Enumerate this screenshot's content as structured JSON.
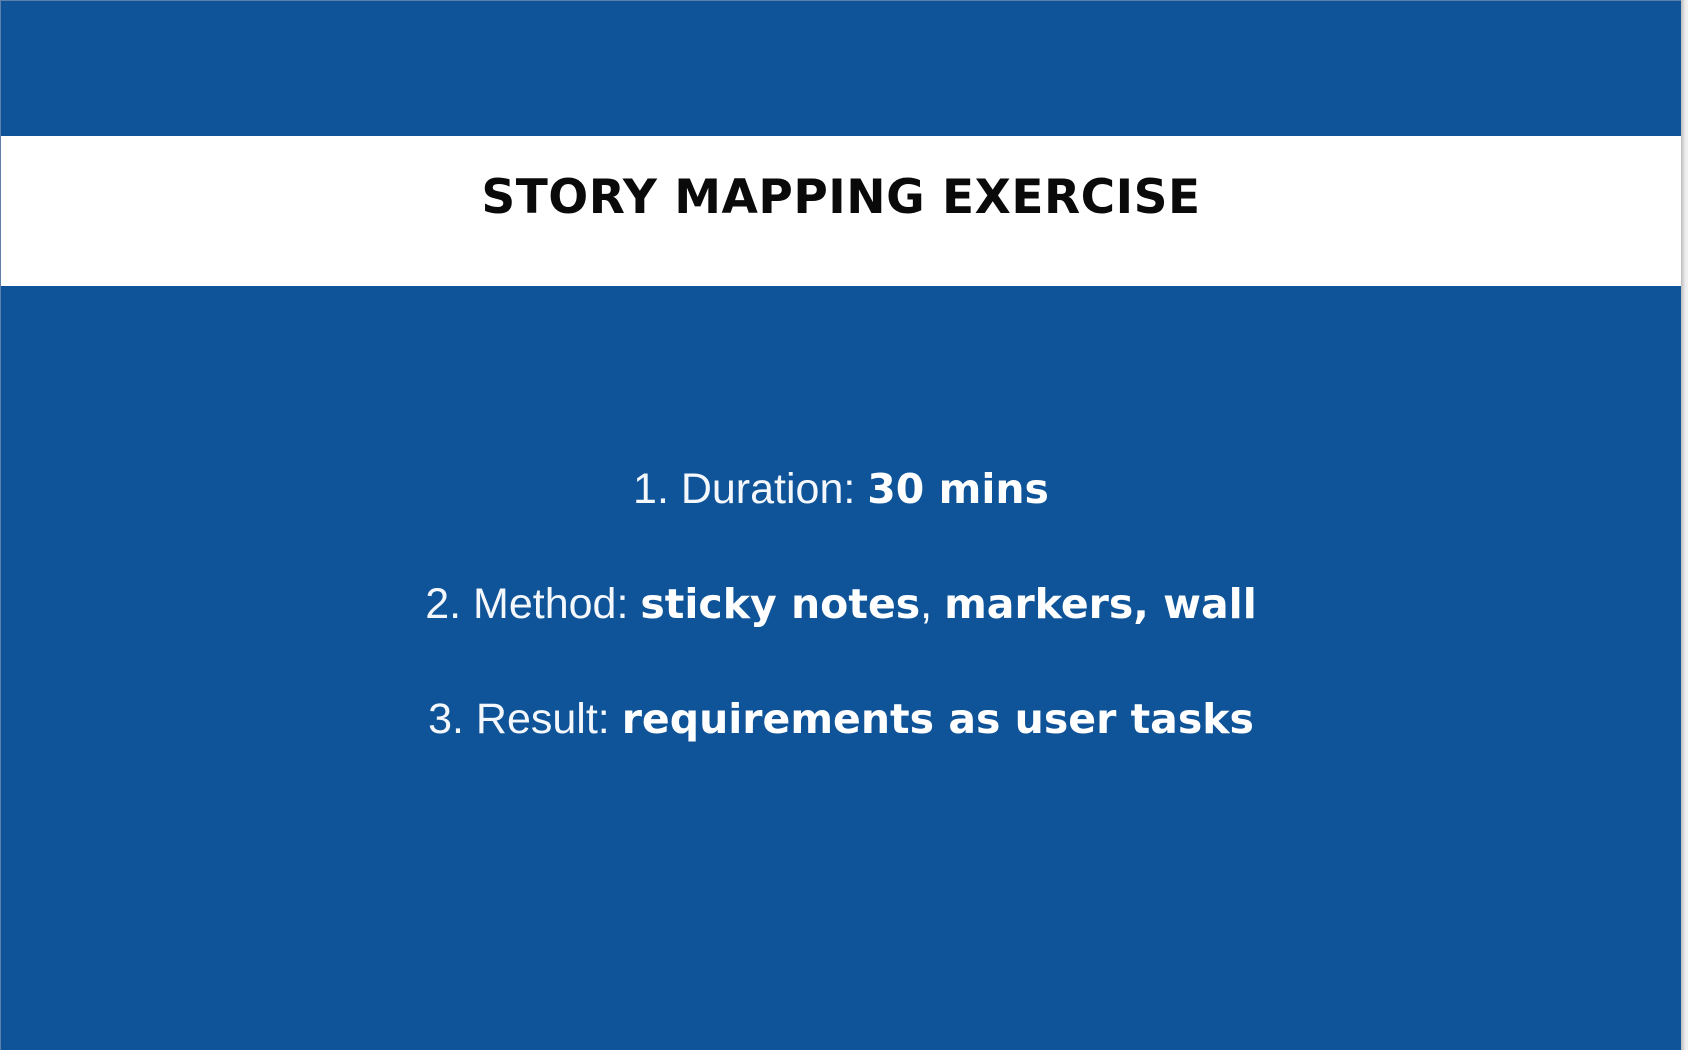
{
  "slide": {
    "title": "STORY MAPPING EXERCISE",
    "items": [
      {
        "label": "1. Duration: ",
        "value": "30 mins"
      },
      {
        "label": "2. Method: ",
        "value_a": "sticky notes",
        "separator": ", ",
        "value_b": "markers, wall"
      },
      {
        "label": "3. Result: ",
        "value": "requirements as user tasks"
      }
    ]
  },
  "colors": {
    "background": "#0f5499",
    "title_band": "#ffffff",
    "title_text": "#0a0a0a",
    "body_text": "#ffffff"
  }
}
